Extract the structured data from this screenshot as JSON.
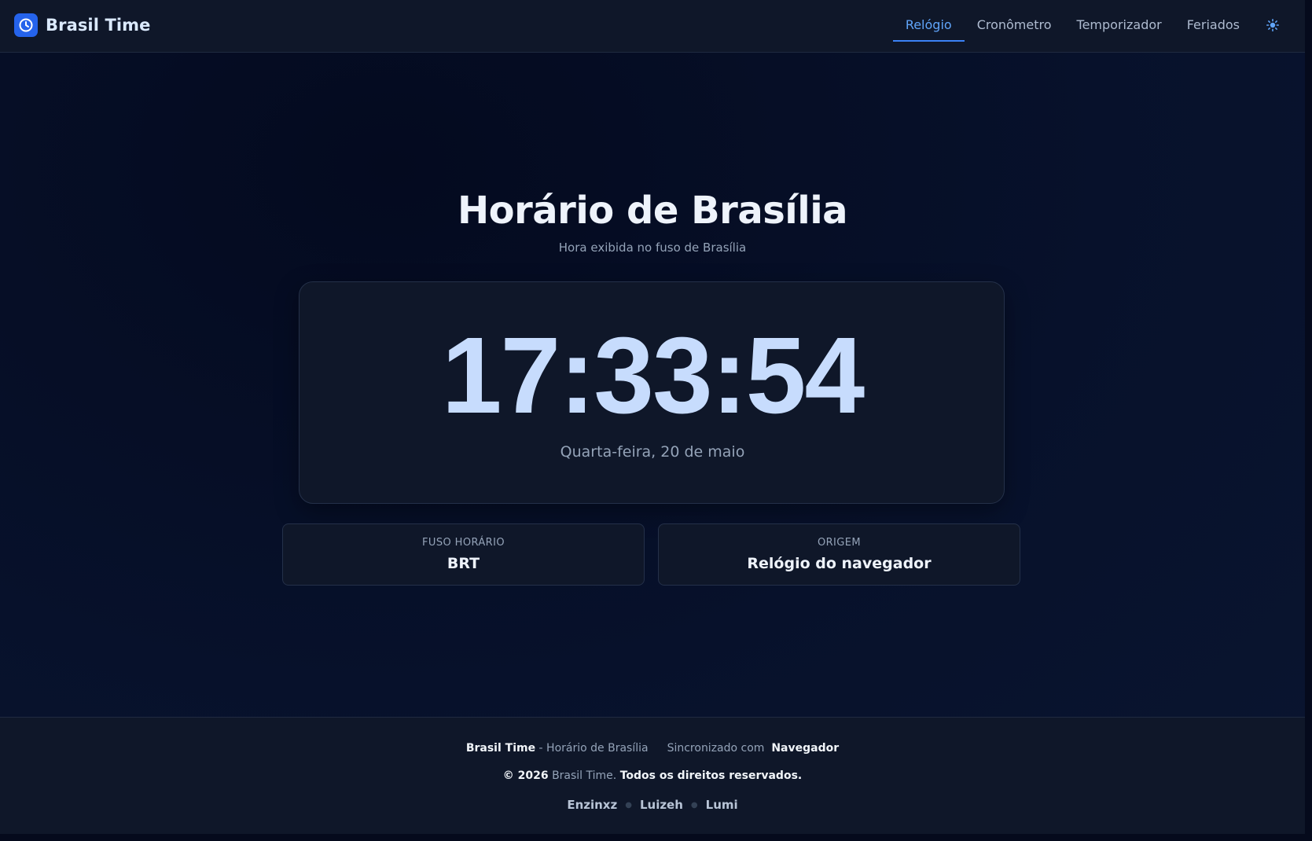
{
  "brand": {
    "name": "Brasil Time",
    "logo_icon": "clock-icon",
    "logo_color": "#2563eb"
  },
  "nav": {
    "items": [
      {
        "label": "Relógio",
        "active": true
      },
      {
        "label": "Cronômetro",
        "active": false
      },
      {
        "label": "Temporizador",
        "active": false
      },
      {
        "label": "Feriados",
        "active": false
      }
    ],
    "theme_toggle_icon": "sun-icon"
  },
  "main": {
    "title": "Horário de Brasília",
    "subtitle": "Hora exibida no fuso de Brasília",
    "clock": {
      "time": "17:33:54",
      "date": "Quarta-feira, 20 de maio"
    },
    "info_cards": [
      {
        "label": "FUSO HORÁRIO",
        "value": "BRT"
      },
      {
        "label": "ORIGEM",
        "value": "Relógio do navegador"
      }
    ]
  },
  "footer": {
    "brand": "Brasil Time",
    "brand_suffix": " - Horário de Brasília",
    "sync_prefix": "Sincronizado com",
    "sync_source": "Navegador",
    "copyright_prefix": "© 2026",
    "copyright_brand": "Brasil Time.",
    "copyright_suffix": "Todos os direitos reservados.",
    "authors": [
      "Enzinxz",
      "Luizeh",
      "Lumi"
    ]
  },
  "colors": {
    "accent": "#3b82f6",
    "accent_text": "#60a5fa",
    "clock_digits": "#c7dcfd",
    "background": "#050a1c",
    "surface": "#0f1729"
  }
}
